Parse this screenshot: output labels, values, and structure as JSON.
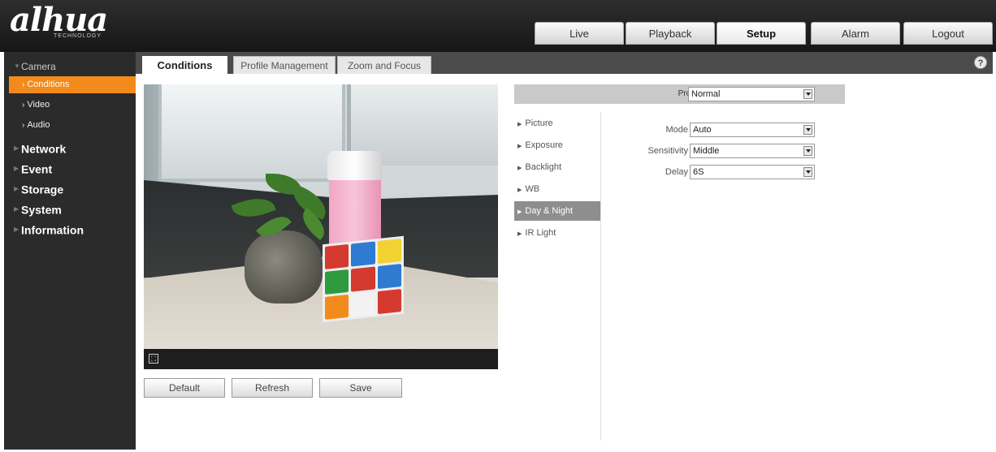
{
  "header": {
    "logo_text": "alhua",
    "logo_sub": "TECHNOLOGY",
    "nav": [
      {
        "label": "Live",
        "active": false
      },
      {
        "label": "Playback",
        "active": false
      },
      {
        "label": "Setup",
        "active": true
      },
      {
        "label": "Alarm",
        "active": false
      },
      {
        "label": "Logout",
        "active": false
      }
    ]
  },
  "sidebar": {
    "camera": "Camera",
    "camera_subitems": [
      {
        "label": "Conditions",
        "active": true
      },
      {
        "label": "Video",
        "active": false
      },
      {
        "label": "Audio",
        "active": false
      }
    ],
    "sections": [
      "Network",
      "Event",
      "Storage",
      "System",
      "Information"
    ]
  },
  "tabs": [
    {
      "label": "Conditions",
      "active": true
    },
    {
      "label": "Profile Management",
      "active": false
    },
    {
      "label": "Zoom and Focus",
      "active": false
    }
  ],
  "help_icon": "?",
  "video": {
    "fullscreen_icon": "fullscreen-icon"
  },
  "buttons": {
    "default": "Default",
    "refresh": "Refresh",
    "save": "Save"
  },
  "profile": {
    "label": "Profile",
    "value": "Normal"
  },
  "menu": [
    {
      "label": "Picture",
      "active": false
    },
    {
      "label": "Exposure",
      "active": false
    },
    {
      "label": "Backlight",
      "active": false
    },
    {
      "label": "WB",
      "active": false
    },
    {
      "label": "Day & Night",
      "active": true
    },
    {
      "label": "IR Light",
      "active": false
    }
  ],
  "fields": {
    "mode": {
      "label": "Mode",
      "value": "Auto"
    },
    "sensitivity": {
      "label": "Sensitivity",
      "value": "Middle"
    },
    "delay": {
      "label": "Delay",
      "value": "6S"
    }
  },
  "colors": {
    "accent": "#f28b1b",
    "sidebar_bg": "#2b2b2b",
    "header_bg": "#1e1e1e"
  }
}
